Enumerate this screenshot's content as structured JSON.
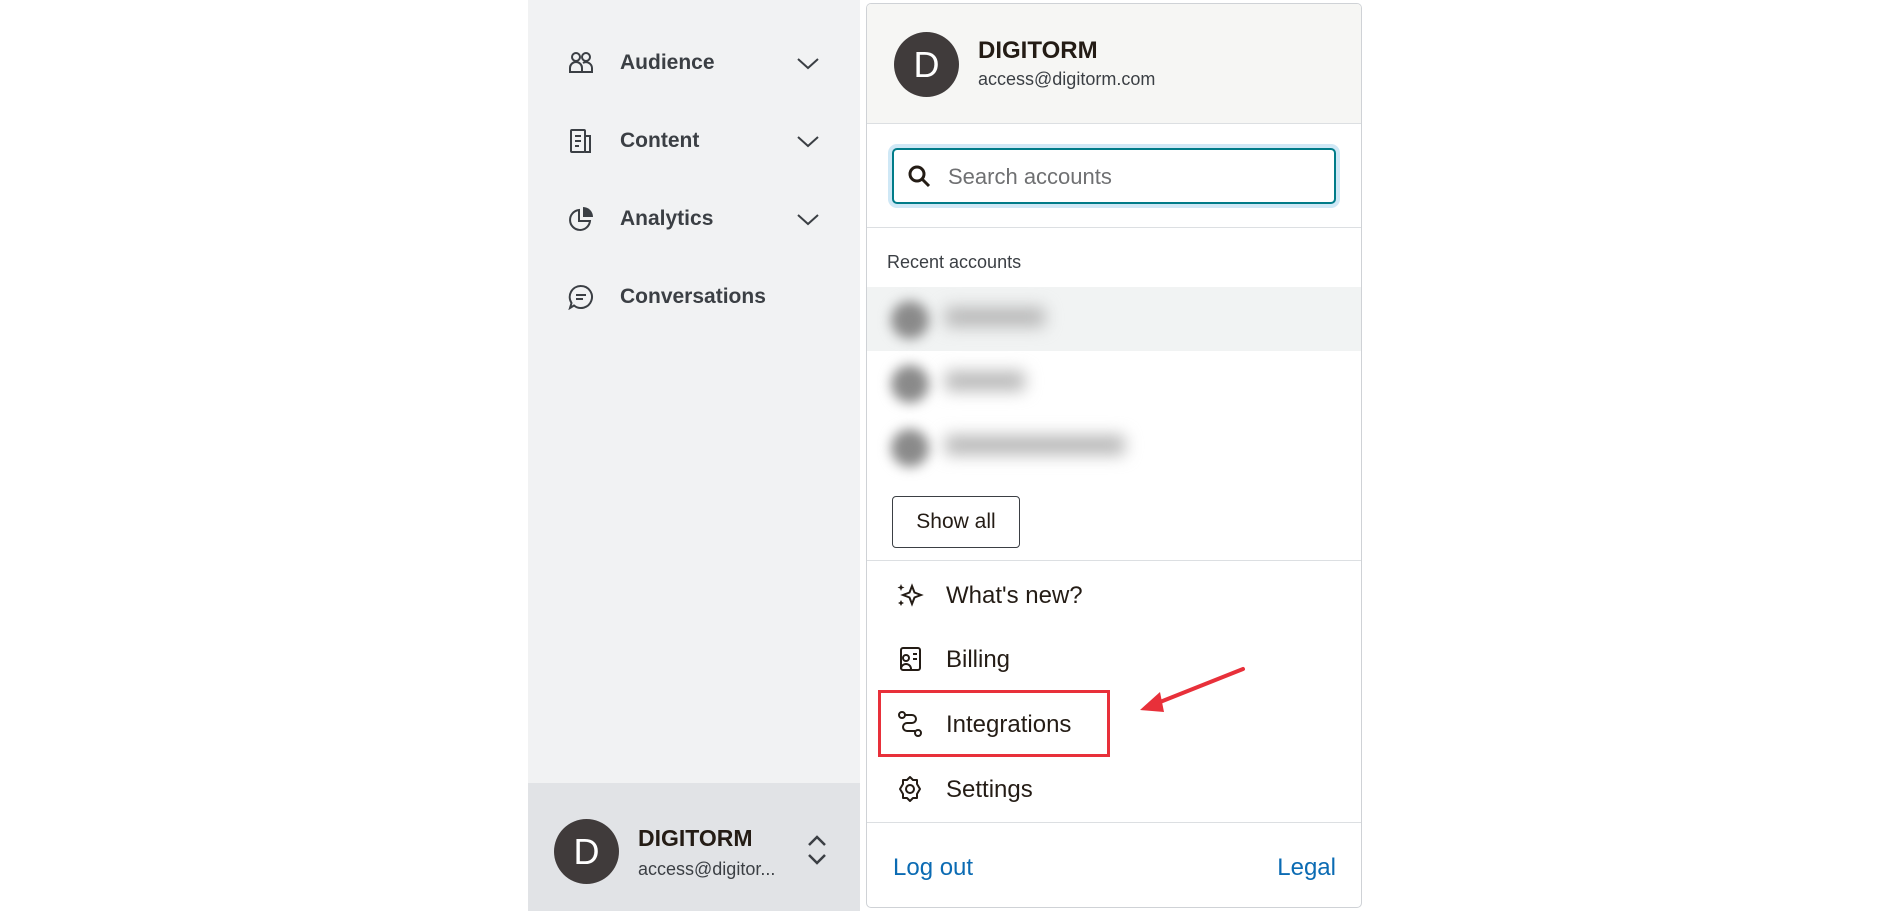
{
  "sidebar": {
    "items": [
      {
        "label": "Audience",
        "icon": "audience-icon",
        "has_chevron": true
      },
      {
        "label": "Content",
        "icon": "content-icon",
        "has_chevron": true
      },
      {
        "label": "Analytics",
        "icon": "analytics-icon",
        "has_chevron": true
      },
      {
        "label": "Conversations",
        "icon": "conversations-icon",
        "has_chevron": false
      }
    ],
    "account": {
      "initial": "D",
      "name": "DIGITORM",
      "email": "access@digitor..."
    }
  },
  "dropdown": {
    "header": {
      "initial": "D",
      "name": "DIGITORM",
      "email": "access@digitorm.com"
    },
    "search": {
      "placeholder": "Search accounts",
      "value": ""
    },
    "recent_label": "Recent accounts",
    "show_all_label": "Show all",
    "menu": [
      {
        "label": "What's new?",
        "icon": "sparkles-icon"
      },
      {
        "label": "Billing",
        "icon": "billing-icon"
      },
      {
        "label": "Integrations",
        "icon": "integrations-icon"
      },
      {
        "label": "Settings",
        "icon": "gear-icon"
      }
    ],
    "footer": {
      "logout_label": "Log out",
      "legal_label": "Legal"
    }
  },
  "colors": {
    "sidebar_bg": "#f1f2f3",
    "account_bar_bg": "#e1e3e6",
    "link": "#0b6bb3",
    "search_focus": "#007c89",
    "annotation_red": "#e8303a"
  }
}
